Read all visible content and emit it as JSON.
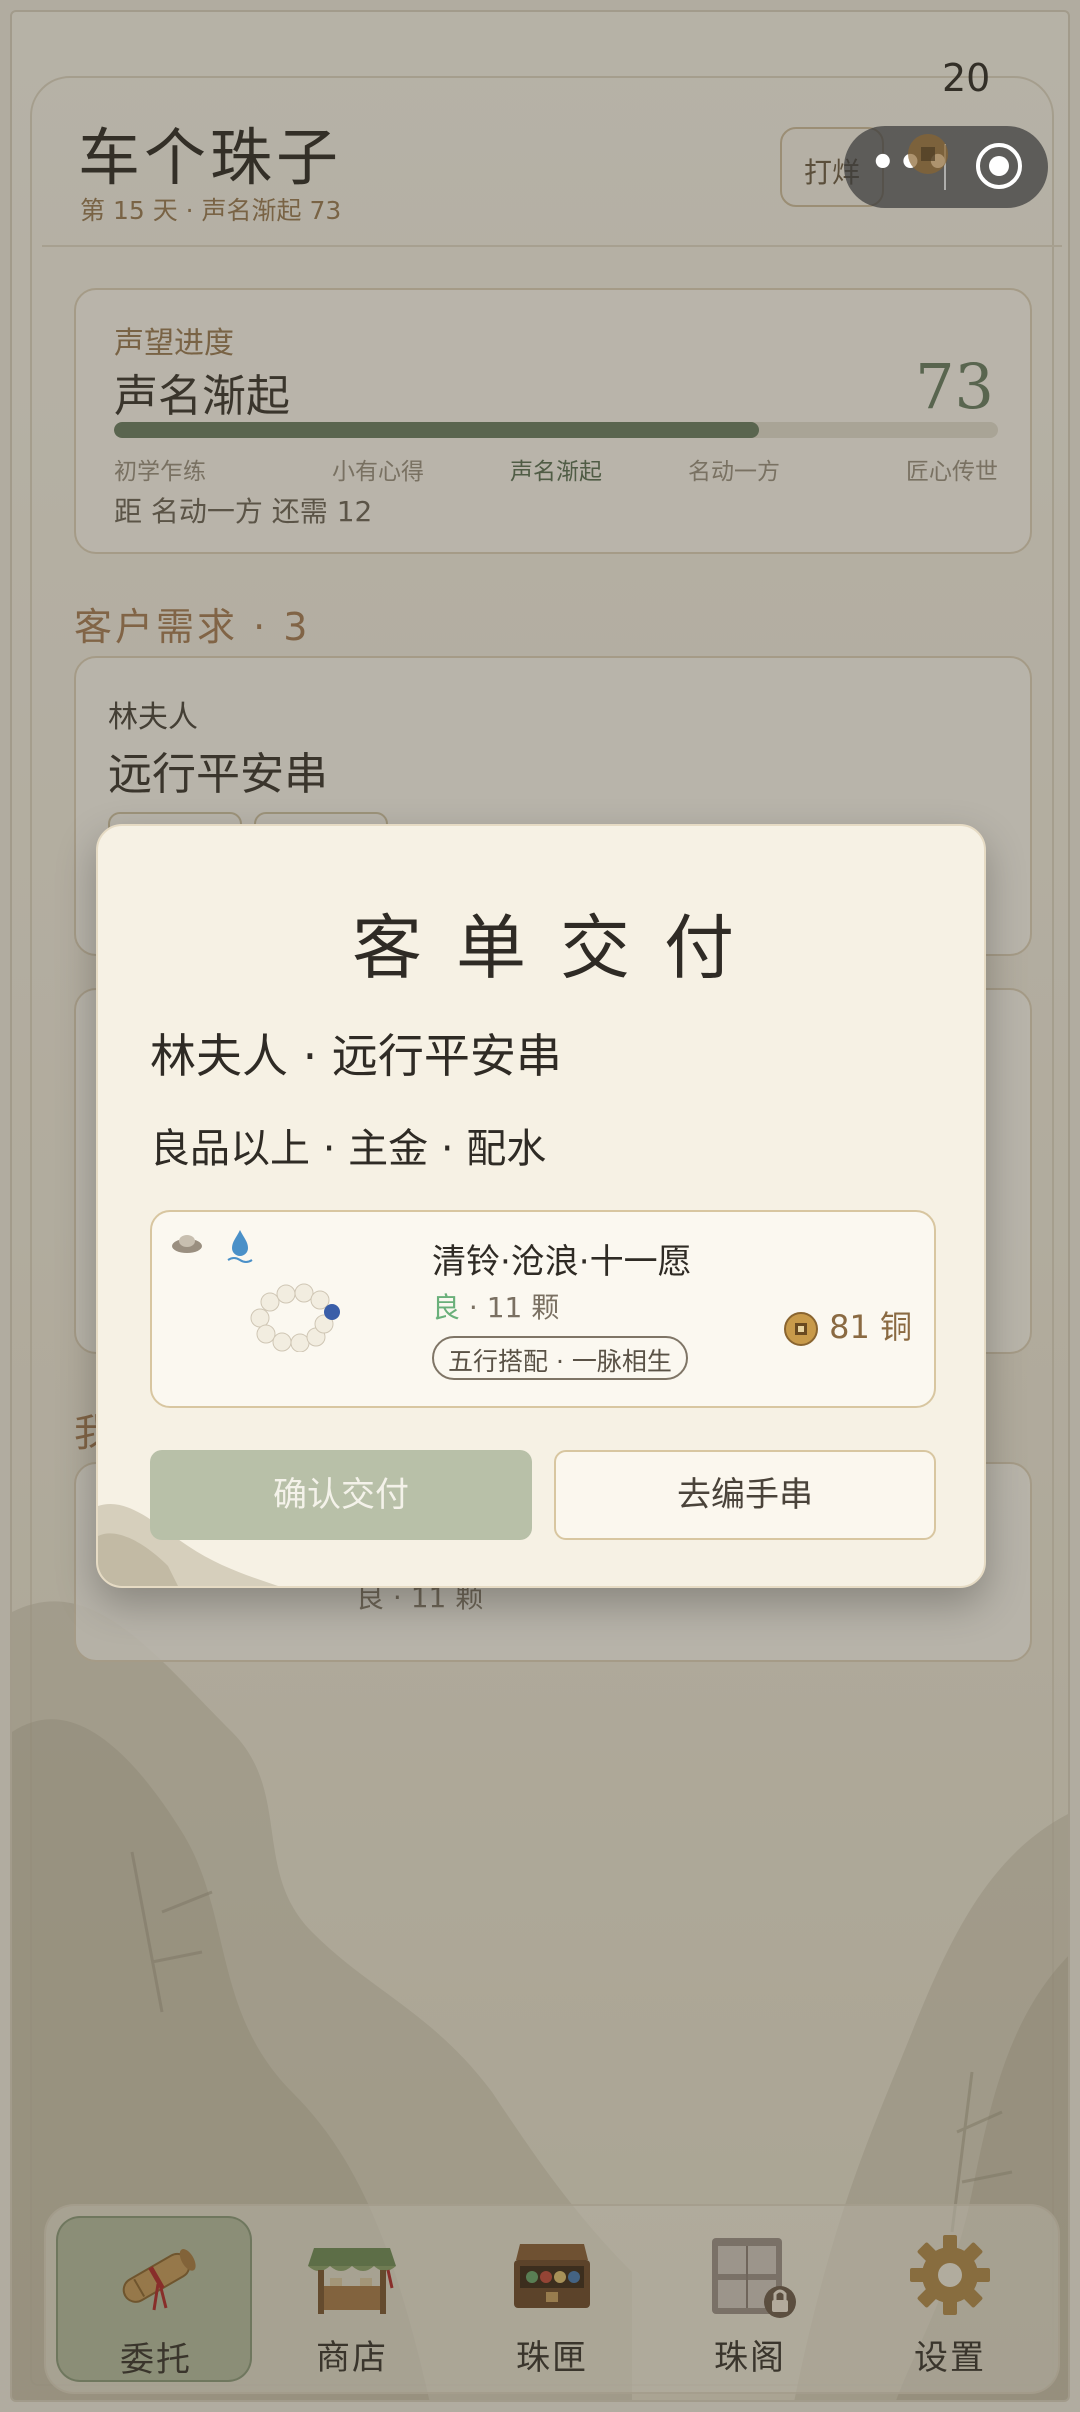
{
  "header": {
    "title": "车个珠子",
    "subtitle": "第 15 天 · 声名渐起 73",
    "sample_button": "打烊",
    "coins": "20"
  },
  "reputation": {
    "label": "声望进度",
    "level": "声名渐起",
    "score": "73",
    "progress": 0.73,
    "stages": [
      "初学乍练",
      "小有心得",
      "声名渐起",
      "名动一方",
      "匠心传世"
    ],
    "active_stage": 2,
    "need_text": "距 名动一方 还需 12"
  },
  "orders_section": {
    "title": "客户需求 · 3",
    "first_order": {
      "customer": "林夫人",
      "name": "远行平安串"
    }
  },
  "my_section": {
    "title": "我",
    "hint_text": "良 · 11 颗"
  },
  "modal": {
    "title": "客单交付",
    "line1": "林夫人 · 远行平安串",
    "line2": "良品以上 · 主金 · 配水",
    "item": {
      "name": "清铃·沧浪·十一愿",
      "grade": "良",
      "count": "· 11 颗",
      "tag": "五行搭配 · 一脉相生",
      "price": "81 铜"
    },
    "confirm_label": "确认交付",
    "weave_label": "去编手串"
  },
  "tabs": [
    {
      "label": "委托",
      "icon": "scroll-icon",
      "active": true
    },
    {
      "label": "商店",
      "icon": "shop-stall-icon",
      "active": false
    },
    {
      "label": "珠匣",
      "icon": "bead-box-icon",
      "active": false
    },
    {
      "label": "珠阁",
      "icon": "locked-cabinet-icon",
      "active": false
    },
    {
      "label": "设置",
      "icon": "gear-icon",
      "active": false
    }
  ],
  "colors": {
    "accent_green": "#6b7d62",
    "label_brown": "#9a7a52",
    "good_grade": "#6ab07a"
  }
}
